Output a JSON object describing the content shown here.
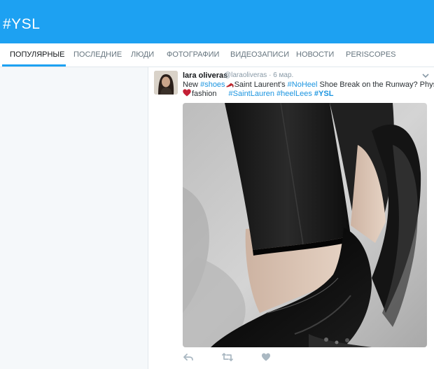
{
  "header": {
    "title": "#YSL"
  },
  "tabs": [
    {
      "label": "ПОПУЛЯРНЫЕ",
      "active": true
    },
    {
      "label": "ПОСЛЕДНИЕ",
      "active": false
    },
    {
      "label": "ЛЮДИ",
      "active": false
    },
    {
      "label": "ФОТОГРАФИИ",
      "active": false
    },
    {
      "label": "ВИДЕОЗАПИСИ",
      "active": false
    },
    {
      "label": "НОВОСТИ",
      "active": false
    },
    {
      "label": "PERISCOPES",
      "active": false
    }
  ],
  "tweet": {
    "author_name": "lara oliveras",
    "handle": "@laraoliveras",
    "date": "6 мар.",
    "text": {
      "w1": "New",
      "h_shoes": "#shoes",
      "w2": "Saint Laurent's",
      "h_noheel": "#NoHeel",
      "w3": "Shoe Break on the Runway? Physics",
      "w4": "fashion",
      "h_saintlauren": "#SaintLauren",
      "h_heellees": "#heelLees",
      "h_ysl": "#YSL"
    },
    "icons": {
      "reply": "reply-icon",
      "retweet": "retweet-icon",
      "like": "heart-icon",
      "more": "chevron-down-icon"
    }
  },
  "colors": {
    "brand": "#1da1f2",
    "link": "#1b95e0",
    "heart": "#c42035"
  }
}
